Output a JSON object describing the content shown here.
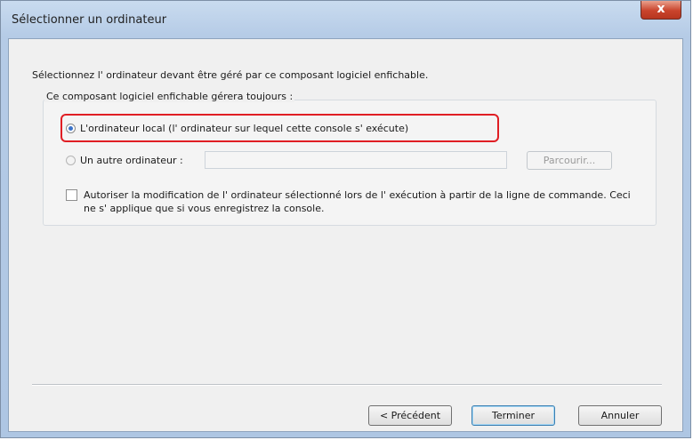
{
  "window": {
    "title": "Sélectionner un ordinateur",
    "close_label": "x"
  },
  "dialog": {
    "instruction": "Sélectionnez l' ordinateur devant être géré par ce composant logiciel enfichable.",
    "group_label": "Ce composant logiciel enfichable gérera toujours :",
    "radio_local": "L'ordinateur local (l' ordinateur sur lequel cette console s' exécute)",
    "radio_other": "Un autre ordinateur :",
    "computer_input_value": "",
    "browse_label": "Parcourir...",
    "checkbox_label": "Autoriser la modification de l' ordinateur sélectionné lors de l' exécution à partir de la ligne de commande. Ceci ne s' applique que si vous enregistrez la console.",
    "checkbox_checked": false,
    "selected_radio": "local"
  },
  "footer": {
    "back_label": "< Précédent",
    "finish_label": "Terminer",
    "cancel_label": "Annuler"
  },
  "colors": {
    "highlight": "#e01e24",
    "close_button": "#c9442c",
    "titlebar": "#b5cbe6"
  }
}
